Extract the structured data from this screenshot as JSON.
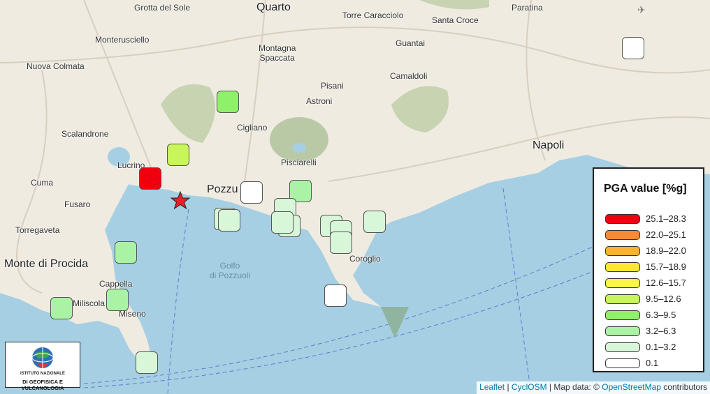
{
  "map": {
    "land_color": "#efebe1",
    "water_color": "#a6cfe3",
    "places": [
      {
        "id": "grotta-del-sole",
        "label": "Grotta del Sole",
        "big": false
      },
      {
        "id": "quarto",
        "label": "Quarto",
        "big": true
      },
      {
        "id": "torre-caracciolo",
        "label": "Torre Caracciolo",
        "big": false
      },
      {
        "id": "paratina",
        "label": "Paratina",
        "big": false
      },
      {
        "id": "monterusciello",
        "label": "Monterusciello",
        "big": false
      },
      {
        "id": "santa-croce",
        "label": "Santa Croce",
        "big": false
      },
      {
        "id": "guantai",
        "label": "Guantai",
        "big": false
      },
      {
        "id": "montagna-spaccata",
        "label": "Montagna\nSpaccata",
        "big": false
      },
      {
        "id": "nuova-colmata",
        "label": "Nuova Colmata",
        "big": false
      },
      {
        "id": "camaldoli",
        "label": "Camaldoli",
        "big": false
      },
      {
        "id": "pisani",
        "label": "Pisani",
        "big": false
      },
      {
        "id": "astroni",
        "label": "Astroni",
        "big": false
      },
      {
        "id": "scalandrone",
        "label": "Scalandrone",
        "big": false
      },
      {
        "id": "cigliano",
        "label": "Cigliano",
        "big": false
      },
      {
        "id": "napoli",
        "label": "Napoli",
        "big": true
      },
      {
        "id": "lucrino",
        "label": "Lucrino",
        "big": false
      },
      {
        "id": "pisciarelli",
        "label": "Pisciarelli",
        "big": false
      },
      {
        "id": "cuma",
        "label": "Cuma",
        "big": false
      },
      {
        "id": "pozzuoli",
        "label": "Pozzu",
        "big": true
      },
      {
        "id": "fusaro",
        "label": "Fusaro",
        "big": false
      },
      {
        "id": "torregaveta",
        "label": "Torregaveta",
        "big": false
      },
      {
        "id": "monte-di-procida",
        "label": "Monte di Procida",
        "big": true
      },
      {
        "id": "coroglio",
        "label": "Coroglio",
        "big": false
      },
      {
        "id": "golfo-di-pozzuoli",
        "label": "Golfo\ndi Pozzuoli",
        "big": false,
        "water": true
      },
      {
        "id": "cappella",
        "label": "Cappella",
        "big": false
      },
      {
        "id": "miliscola",
        "label": "Miliscola",
        "big": false
      },
      {
        "id": "miseno",
        "label": "Miseno",
        "big": false
      }
    ]
  },
  "epicenter": {
    "label": "epicenter",
    "color": "#e8202a"
  },
  "stations": [
    {
      "pga_class": "6.3–9.5"
    },
    {
      "pga_class": "9.5–12.6"
    },
    {
      "pga_class": "25.1–28.3"
    },
    {
      "pga_class": "0.1"
    },
    {
      "pga_class": "3.2–6.3"
    },
    {
      "pga_class": "0.1"
    },
    {
      "pga_class": "0.1–3.2"
    },
    {
      "pga_class": "0.1–3.2"
    },
    {
      "pga_class": "0.1–3.2"
    },
    {
      "pga_class": "0.1–3.2"
    },
    {
      "pga_class": "0.1–3.2"
    },
    {
      "pga_class": "0.1–3.2"
    },
    {
      "pga_class": "0.1–3.2"
    },
    {
      "pga_class": "0.1–3.2"
    },
    {
      "pga_class": "0.1–3.2"
    },
    {
      "pga_class": "0.1–3.2"
    },
    {
      "pga_class": "0.1"
    },
    {
      "pga_class": "3.2–6.3"
    },
    {
      "pga_class": "0.1"
    },
    {
      "pga_class": "3.2–6.3"
    },
    {
      "pga_class": "3.2–6.3"
    },
    {
      "pga_class": "0.1–3.2"
    }
  ],
  "legend": {
    "title": "PGA value [%g]",
    "items": [
      {
        "label": "25.1–28.3",
        "color": "#f0000f"
      },
      {
        "label": "22.0–25.1",
        "color": "#f98a34"
      },
      {
        "label": "18.9–22.0",
        "color": "#fdb42d"
      },
      {
        "label": "15.7–18.9",
        "color": "#fde634"
      },
      {
        "label": "12.6–15.7",
        "color": "#fdf640"
      },
      {
        "label": "9.5–12.6",
        "color": "#c8f55a"
      },
      {
        "label": "6.3–9.5",
        "color": "#8ff06a"
      },
      {
        "label": "3.2–6.3",
        "color": "#aaf3a4"
      },
      {
        "label": "0.1–3.2",
        "color": "#d8f6d8"
      },
      {
        "label": "0.1",
        "color": "#ffffff"
      }
    ]
  },
  "logo": {
    "line1": "ISTITUTO NAZIONALE",
    "line2": "DI GEOFISICA E VULCANOLOGIA"
  },
  "attribution": {
    "leaflet": "Leaflet",
    "sep1": " | ",
    "cyclosm": "CyclOSM",
    "sep2": " | Map data: © ",
    "osm": "OpenStreetMap",
    "suffix": " contributors"
  }
}
